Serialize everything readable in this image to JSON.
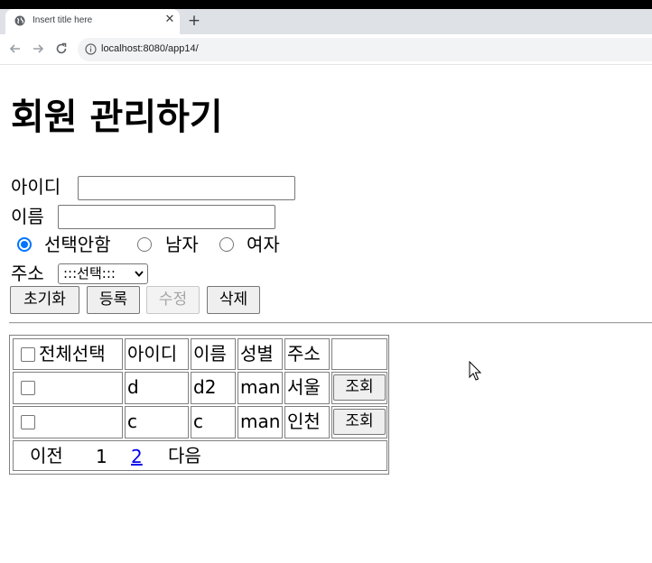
{
  "browser": {
    "tab_title": "Insert title here",
    "url": "localhost:8080/app14/"
  },
  "page": {
    "heading": "회원 관리하기",
    "id_label": "아이디",
    "id_value": "",
    "name_label": "이름",
    "name_value": "",
    "gender_options": [
      "선택안함",
      "남자",
      "여자"
    ],
    "gender_selected": "선택안함",
    "address_label": "주소",
    "address_selected": ":::선택:::",
    "buttons": {
      "reset": "초기화",
      "register": "등록",
      "edit": "수정",
      "delete": "삭제"
    }
  },
  "table": {
    "headers": {
      "select_all": "전체선택",
      "id": "아이디",
      "name": "이름",
      "gender": "성별",
      "address": "주소",
      "action": ""
    },
    "rows": [
      {
        "id": "d",
        "name": "d2",
        "gender": "man",
        "address": "서울",
        "action": "조회"
      },
      {
        "id": "c",
        "name": "c",
        "gender": "man",
        "address": "인천",
        "action": "조회"
      }
    ],
    "pagination": {
      "prev": "이전",
      "pages": [
        "1",
        "2"
      ],
      "current": "1",
      "next": "다음"
    }
  },
  "colors": {
    "radio_accent": "#0075ff",
    "link": "#0000ee"
  }
}
